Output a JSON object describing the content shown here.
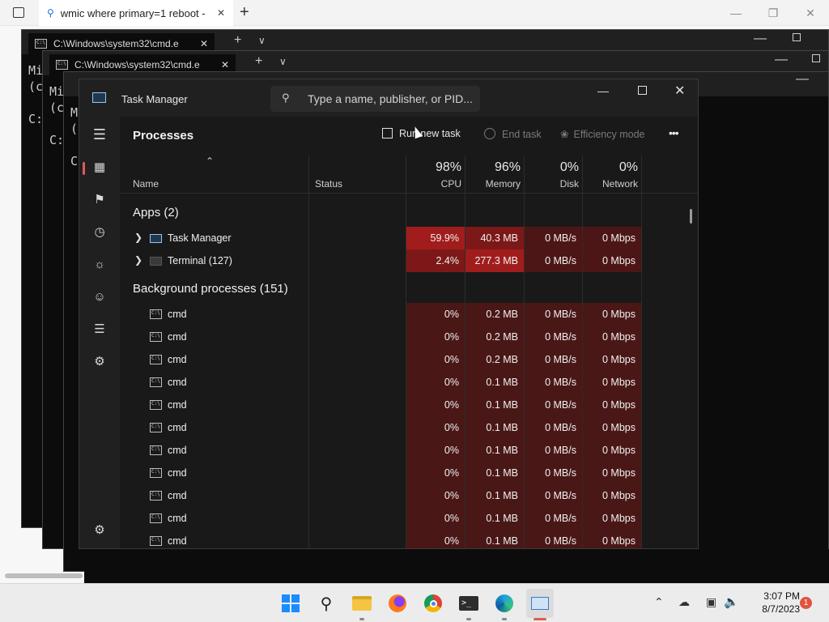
{
  "browser": {
    "tab_title": "wmic where primary=1 reboot -",
    "close": "✕",
    "new_tab": "+"
  },
  "terminals": [
    {
      "tab": "C:\\Windows\\system32\\cmd.e",
      "lines": [
        "Mi",
        "(c",
        "",
        "C:"
      ]
    },
    {
      "tab": "C:\\Windows\\system32\\cmd.e",
      "lines": [
        "Mi",
        "(c",
        "",
        "C:"
      ]
    },
    {
      "tab": "",
      "lines": [
        "M",
        "(",
        "",
        "C"
      ]
    }
  ],
  "task_manager": {
    "title": "Task Manager",
    "search_placeholder": "Type a name, publisher, or PID...",
    "page_title": "Processes",
    "toolbar": {
      "run_new_task": "Run new task",
      "end_task": "End task",
      "efficiency_mode": "Efficiency mode",
      "more": "•••"
    },
    "columns": {
      "name": "Name",
      "status": "Status",
      "cpu": {
        "pct": "98%",
        "label": "CPU"
      },
      "memory": {
        "pct": "96%",
        "label": "Memory"
      },
      "disk": {
        "pct": "0%",
        "label": "Disk"
      },
      "network": {
        "pct": "0%",
        "label": "Network"
      }
    },
    "apps_group": "Apps (2)",
    "apps": [
      {
        "name": "Task Manager",
        "cpu": "59.9%",
        "memory": "40.3 MB",
        "disk": "0 MB/s",
        "network": "0 Mbps"
      },
      {
        "name": "Terminal (127)",
        "cpu": "2.4%",
        "memory": "277.3 MB",
        "disk": "0 MB/s",
        "network": "0 Mbps"
      }
    ],
    "bg_group": "Background processes (151)",
    "background": [
      {
        "name": "cmd",
        "cpu": "0%",
        "memory": "0.2 MB",
        "disk": "0 MB/s",
        "network": "0 Mbps"
      },
      {
        "name": "cmd",
        "cpu": "0%",
        "memory": "0.2 MB",
        "disk": "0 MB/s",
        "network": "0 Mbps"
      },
      {
        "name": "cmd",
        "cpu": "0%",
        "memory": "0.2 MB",
        "disk": "0 MB/s",
        "network": "0 Mbps"
      },
      {
        "name": "cmd",
        "cpu": "0%",
        "memory": "0.1 MB",
        "disk": "0 MB/s",
        "network": "0 Mbps"
      },
      {
        "name": "cmd",
        "cpu": "0%",
        "memory": "0.1 MB",
        "disk": "0 MB/s",
        "network": "0 Mbps"
      },
      {
        "name": "cmd",
        "cpu": "0%",
        "memory": "0.1 MB",
        "disk": "0 MB/s",
        "network": "0 Mbps"
      },
      {
        "name": "cmd",
        "cpu": "0%",
        "memory": "0.1 MB",
        "disk": "0 MB/s",
        "network": "0 Mbps"
      },
      {
        "name": "cmd",
        "cpu": "0%",
        "memory": "0.1 MB",
        "disk": "0 MB/s",
        "network": "0 Mbps"
      },
      {
        "name": "cmd",
        "cpu": "0%",
        "memory": "0.1 MB",
        "disk": "0 MB/s",
        "network": "0 Mbps"
      },
      {
        "name": "cmd",
        "cpu": "0%",
        "memory": "0.1 MB",
        "disk": "0 MB/s",
        "network": "0 Mbps"
      },
      {
        "name": "cmd",
        "cpu": "0%",
        "memory": "0.1 MB",
        "disk": "0 MB/s",
        "network": "0 Mbps"
      }
    ],
    "sidebar_icons": [
      "hamburger-menu-icon",
      "processes-icon",
      "performance-icon",
      "app-history-icon",
      "startup-apps-icon",
      "users-icon",
      "details-icon",
      "services-icon",
      "settings-icon"
    ],
    "colors": {
      "cpu_high": "#9e1a1a",
      "cpu_mid": "#7a1717",
      "heat_low": "#4a1717"
    }
  },
  "taskbar": {
    "time": "3:07 PM",
    "date": "8/7/2023",
    "notifications": "1",
    "icons": [
      "windows-start-icon",
      "search-icon",
      "file-explorer-icon",
      "firefox-icon",
      "chrome-icon",
      "terminal-icon",
      "edge-icon",
      "task-manager-icon"
    ]
  }
}
